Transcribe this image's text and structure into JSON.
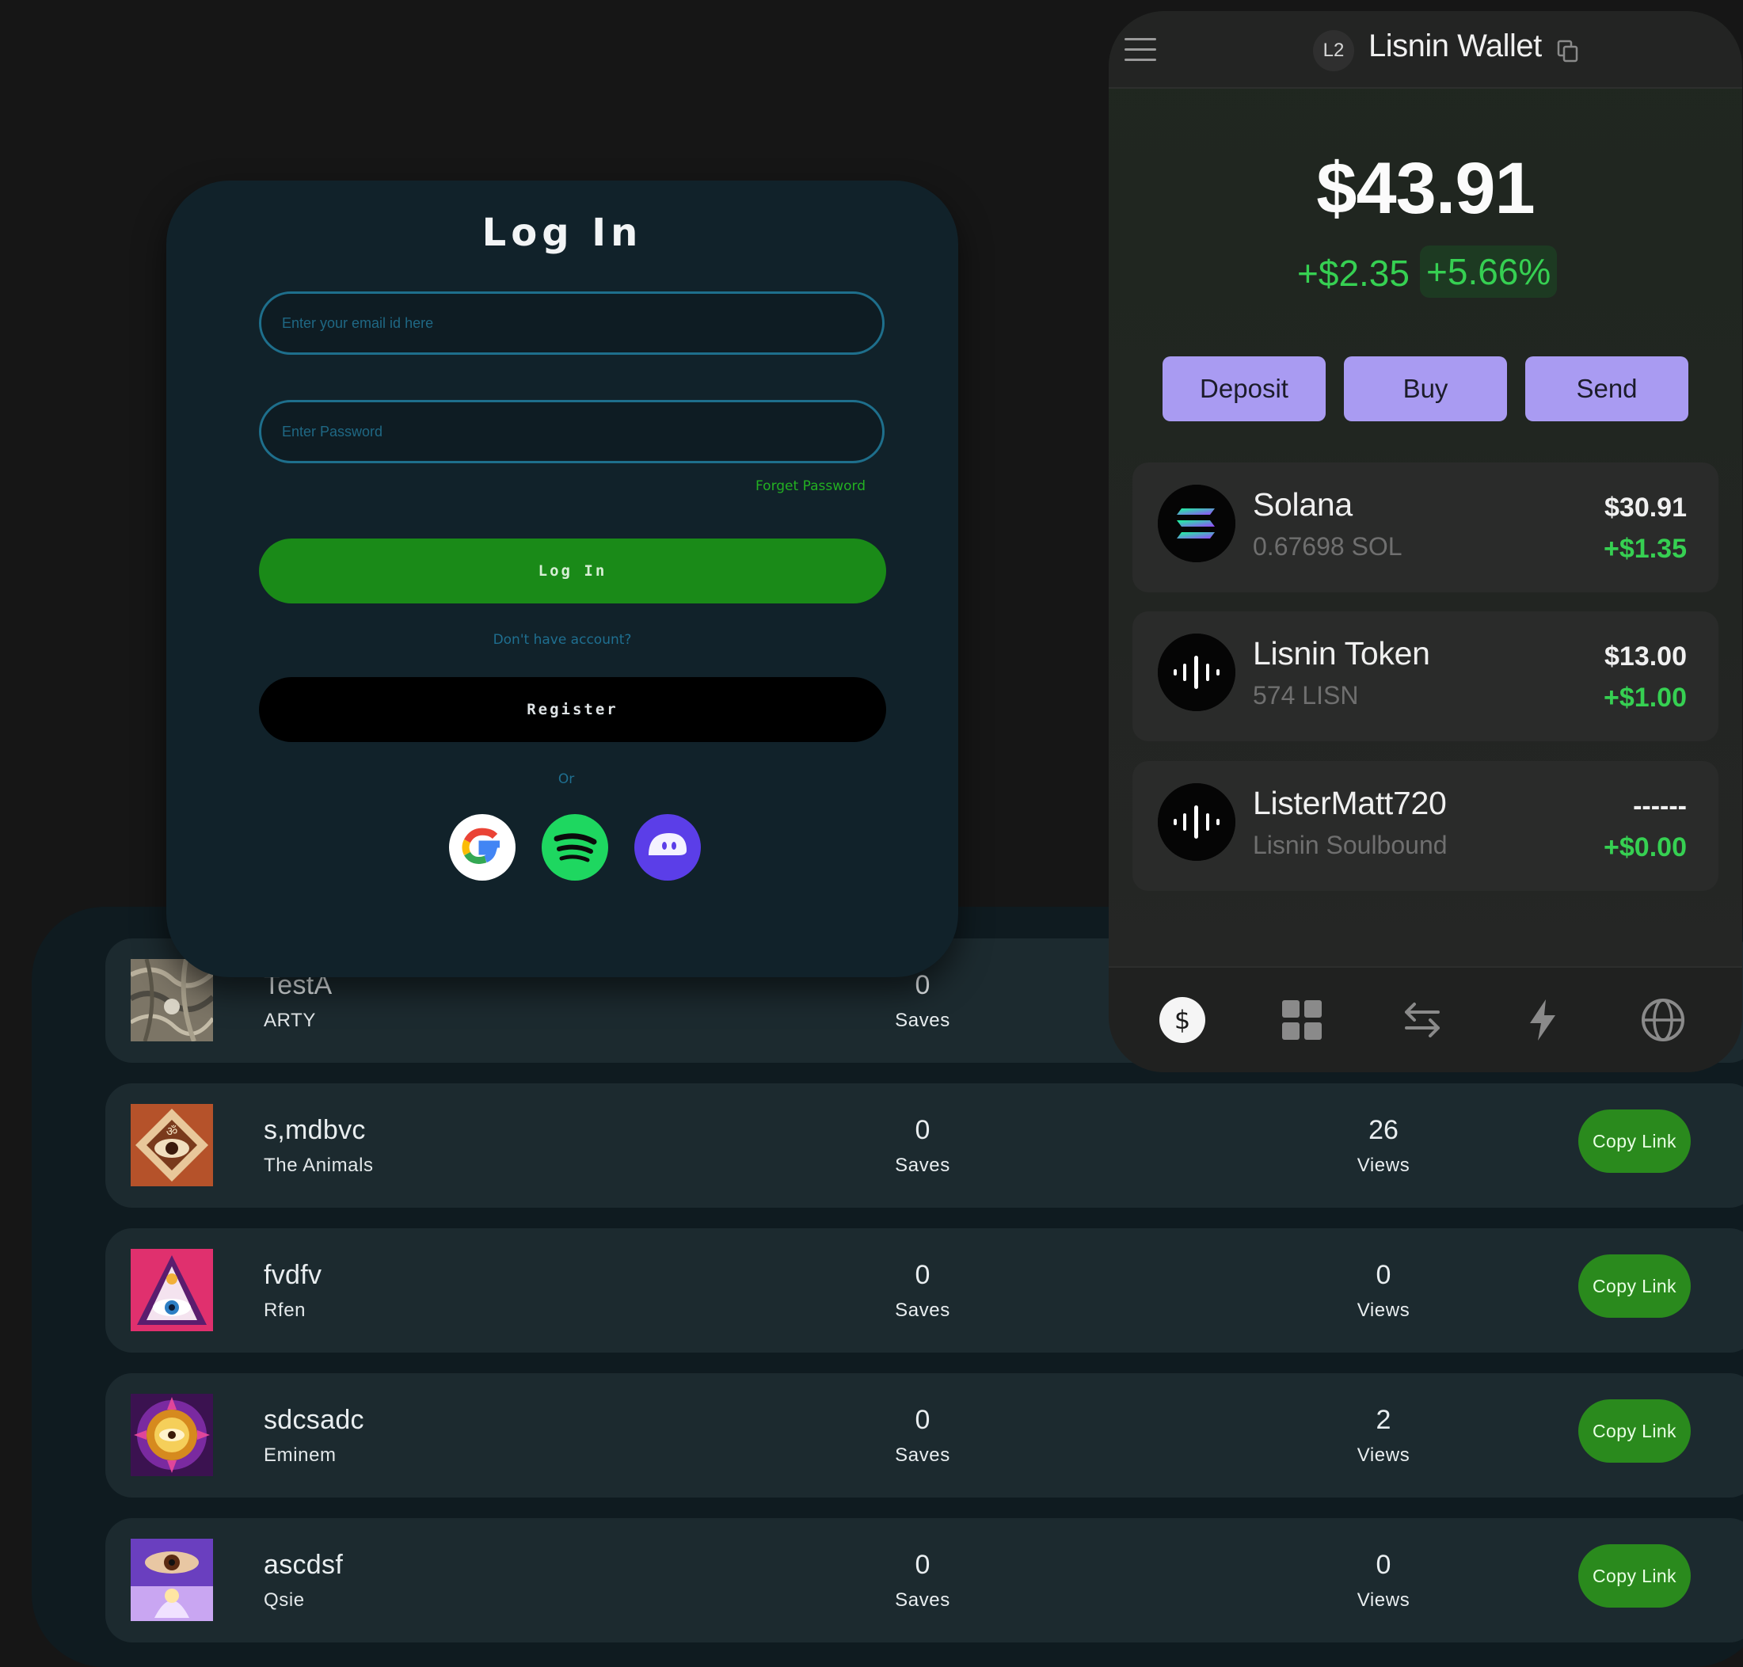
{
  "login": {
    "heading": "Log In",
    "email_placeholder": "Enter your email id here",
    "password_placeholder": "Enter Password",
    "forgot_password": "Forget Password",
    "login_button": "Log In",
    "no_account": "Don't have account?",
    "register_button": "Register",
    "or_text": "Or",
    "social": [
      "google-icon",
      "spotify-icon",
      "phantom-icon"
    ]
  },
  "wallet": {
    "badge": "L2",
    "title": "Lisnin Wallet",
    "balance": "$43.91",
    "change_abs": "+$2.35",
    "change_pct": "+5.66%",
    "actions": [
      "Deposit",
      "Buy",
      "Send"
    ],
    "accent_color": "#a99bf2",
    "positive_color": "#36d052",
    "assets": [
      {
        "name": "Solana",
        "sub": "0.67698 SOL",
        "value": "$30.91",
        "delta": "+$1.35",
        "icon": "solana-icon"
      },
      {
        "name": "Lisnin Token",
        "sub": "574 LISN",
        "value": "$13.00",
        "delta": "+$1.00",
        "icon": "lisnin-waveform-icon"
      },
      {
        "name": "ListerMatt720",
        "sub": "Lisnin Soulbound",
        "value": "------",
        "delta": "+$0.00",
        "icon": "lisnin-waveform-icon"
      }
    ],
    "nav": [
      "dollar-icon",
      "grid-icon",
      "swap-icon",
      "lightning-icon",
      "globe-icon"
    ]
  },
  "library": {
    "copy_label": "Copy Link",
    "saves_label": "Saves",
    "views_label": "Views",
    "rows": [
      {
        "title": "TestA",
        "artist": "ARTY",
        "saves": "0",
        "views": "",
        "thumb": "textured-artwork-thumbnail"
      },
      {
        "title": "s,mdbvc",
        "artist": "The Animals",
        "saves": "0",
        "views": "26",
        "thumb": "eye-diamond-artwork-thumbnail"
      },
      {
        "title": "fvdfv",
        "artist": "Rfen",
        "saves": "0",
        "views": "0",
        "thumb": "pink-eye-pyramid-thumbnail"
      },
      {
        "title": "sdcsadc",
        "artist": "Eminem",
        "saves": "0",
        "views": "2",
        "thumb": "purple-mandala-eye-thumbnail"
      },
      {
        "title": "ascdsf",
        "artist": "Qsie",
        "saves": "0",
        "views": "0",
        "thumb": "purple-eye-figure-thumbnail"
      }
    ]
  }
}
